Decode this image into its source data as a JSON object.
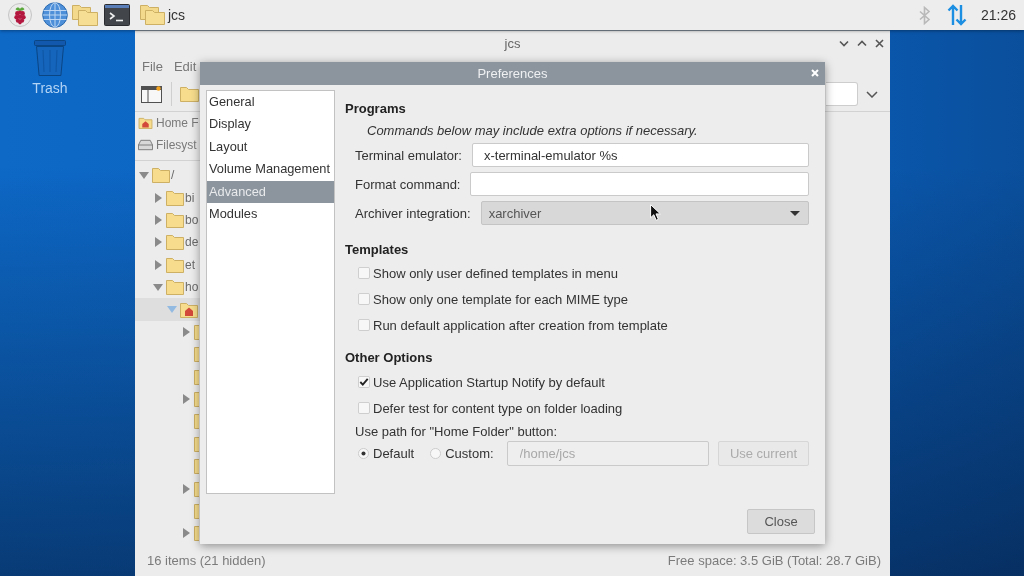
{
  "taskbar": {
    "task_buttons": [
      {
        "label": "jcs"
      }
    ],
    "clock": "21:26"
  },
  "desktop": {
    "icons": [
      {
        "kind": "trash",
        "label": "Trash"
      }
    ]
  },
  "file_manager": {
    "title": "jcs",
    "menu": [
      "File",
      "Edit"
    ],
    "places": [
      {
        "kind": "home",
        "label": "Home F"
      },
      {
        "kind": "drive",
        "label": "Filesyst"
      }
    ],
    "tree": [
      {
        "kind": "folder",
        "label": "/",
        "expandable": true,
        "expanded": true,
        "selected": false,
        "children": [
          {
            "kind": "folder",
            "label": "bi",
            "expandable": true,
            "expanded": false,
            "selected": false
          },
          {
            "kind": "folder",
            "label": "bo",
            "expandable": true,
            "expanded": false,
            "selected": false
          },
          {
            "kind": "folder",
            "label": "de",
            "expandable": true,
            "expanded": false,
            "selected": false
          },
          {
            "kind": "folder",
            "label": "et",
            "expandable": true,
            "expanded": false,
            "selected": false
          },
          {
            "kind": "folder",
            "label": "ho",
            "expandable": true,
            "expanded": true,
            "selected": false,
            "children": [
              {
                "kind": "home",
                "expandable": true,
                "expanded": true,
                "selected": true,
                "children": [
                  {
                    "kind": "folder",
                    "expandable": true,
                    "expanded": false,
                    "selected": false
                  },
                  {
                    "kind": "folder",
                    "expandable": false,
                    "selected": false
                  },
                  {
                    "kind": "folder",
                    "expandable": false,
                    "selected": false
                  },
                  {
                    "kind": "folder",
                    "expandable": true,
                    "expanded": false,
                    "selected": false
                  },
                  {
                    "kind": "folder",
                    "expandable": false,
                    "selected": false
                  },
                  {
                    "kind": "folder",
                    "expandable": false,
                    "selected": false
                  },
                  {
                    "kind": "folder",
                    "expandable": false,
                    "selected": false
                  },
                  {
                    "kind": "folder",
                    "expandable": true,
                    "expanded": false,
                    "selected": false
                  },
                  {
                    "kind": "folder",
                    "expandable": false,
                    "selected": false
                  },
                  {
                    "kind": "folder",
                    "expandable": true,
                    "expanded": false,
                    "selected": false
                  }
                ]
              }
            ]
          }
        ]
      }
    ],
    "status_left": "16 items (21 hidden)",
    "status_right": "Free space: 3.5 GiB (Total: 28.7 GiB)"
  },
  "dialog": {
    "title": "Preferences",
    "categories": [
      {
        "label": "General",
        "selected": false
      },
      {
        "label": "Display",
        "selected": false
      },
      {
        "label": "Layout",
        "selected": false
      },
      {
        "label": "Volume Management",
        "selected": false
      },
      {
        "label": "Advanced",
        "selected": true
      },
      {
        "label": "Modules",
        "selected": false
      }
    ],
    "programs": {
      "heading": "Programs",
      "note": "Commands below may include extra options if necessary.",
      "fields": [
        {
          "kind": "entry",
          "label": "Terminal emulator:",
          "value": "x-terminal-emulator %s"
        },
        {
          "kind": "entry",
          "label": "Format command:"
        },
        {
          "kind": "dropdown",
          "label": "Archiver integration:",
          "value": "xarchiver"
        }
      ]
    },
    "templates": {
      "heading": "Templates",
      "options": [
        {
          "label": "Show only user defined templates in menu",
          "checked": false
        },
        {
          "label": "Show only one template for each MIME type",
          "checked": false
        },
        {
          "label": "Run default application after creation from template",
          "checked": false
        }
      ]
    },
    "other_options": {
      "heading": "Other Options",
      "options": [
        {
          "label": "Use Application Startup Notify by default",
          "checked": true
        },
        {
          "label": "Defer test for content type on folder loading",
          "checked": false
        }
      ],
      "home_path": {
        "label": "Use path for \"Home Folder\" button:",
        "choices": [
          {
            "label": "Default",
            "selected": true
          },
          {
            "label": "Custom:",
            "selected": false
          }
        ],
        "path_field": {
          "value": "/home/jcs",
          "disabled": true
        },
        "use_current_button": {
          "label": "Use current",
          "disabled": true
        }
      }
    },
    "close_button": "Close"
  }
}
